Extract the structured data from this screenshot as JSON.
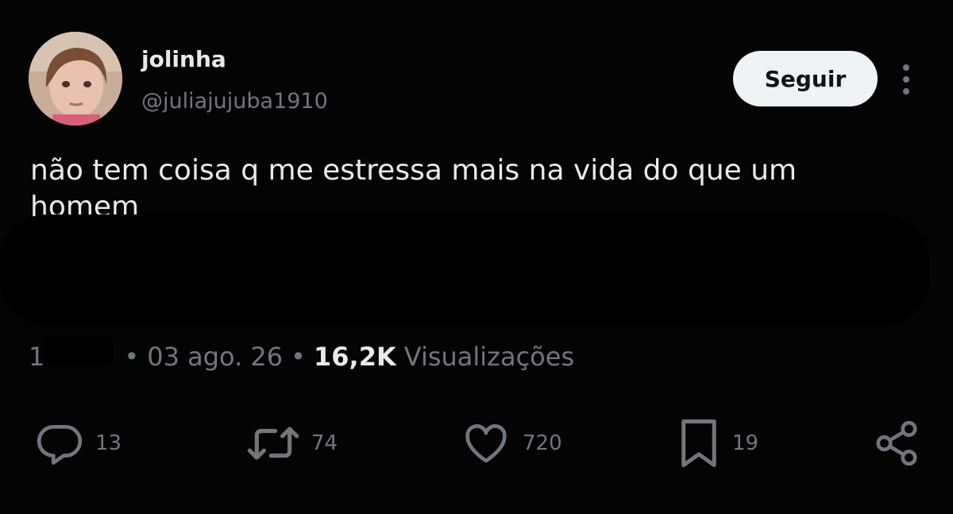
{
  "author": {
    "display_name": "jolinha",
    "handle": "@juliajujuba1910"
  },
  "follow_button": {
    "label": "Seguir"
  },
  "tweet": {
    "text": "não tem coisa q me estressa mais na vida do que um homem"
  },
  "meta": {
    "time_partial": "1",
    "separator": "•",
    "date": "03 ago. 26",
    "views_count": "16,2K",
    "views_label": "Visualizações"
  },
  "actions": {
    "reply": {
      "icon": "reply-icon",
      "count": "13"
    },
    "repost": {
      "icon": "repost-icon",
      "count": "74"
    },
    "like": {
      "icon": "heart-icon",
      "count": "720"
    },
    "bookmark": {
      "icon": "bookmark-icon",
      "count": "19"
    },
    "share": {
      "icon": "share-icon"
    }
  },
  "colors": {
    "background": "#040404",
    "primary_text": "#e7e9ea",
    "secondary_text": "#71767b",
    "button_bg": "#eff3f4",
    "icon": "#71767b"
  }
}
